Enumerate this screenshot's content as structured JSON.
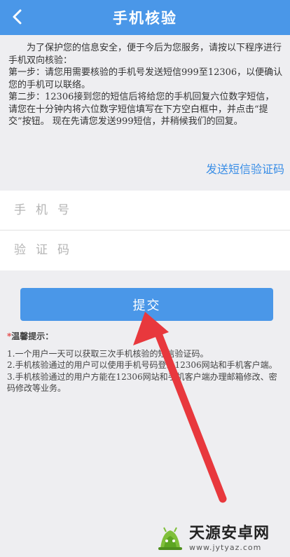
{
  "header": {
    "title": "手机核验",
    "back_icon": "chevron-left-icon"
  },
  "intro": {
    "paragraph1": "为了保护您的信息安全，便于今后为您服务，请按以下程序进行手机双向核验：",
    "step1": "第一步：请您用需要核验的手机号发送短信999至12306，以便确认您的手机可以联络。",
    "step2": "第二步：12306接到您的短信后将给您的手机回复六位数字短信，请您在十分钟内将六位数字短信填写在下方空白框中，并点击“提交”按钮。 现在先请您发送999短信，并稍候我们的回复。"
  },
  "send_link": "发送短信验证码",
  "form": {
    "phone_placeholder": "手机号",
    "phone_value": "",
    "code_placeholder": "验证码",
    "code_value": ""
  },
  "submit_label": "提交",
  "tips": {
    "star": "*",
    "title": "温馨提示：",
    "items": [
      "1.一个用户一天可以获取三次手机核验的短信验证码。",
      "2.手机核验通过的用户可以使用手机号码登录12306网站和手机客户端。",
      "3.手机核验通过的用户方能在12306网站和手机客户端办理邮箱修改、密码修改等业务。"
    ]
  },
  "watermark": {
    "name": "天源安卓网",
    "url": "www.jytyaz.com"
  },
  "colors": {
    "primary": "#4a97e8",
    "link": "#3a8ee6",
    "arrow": "#e8383d",
    "background": "#eeeef1"
  }
}
